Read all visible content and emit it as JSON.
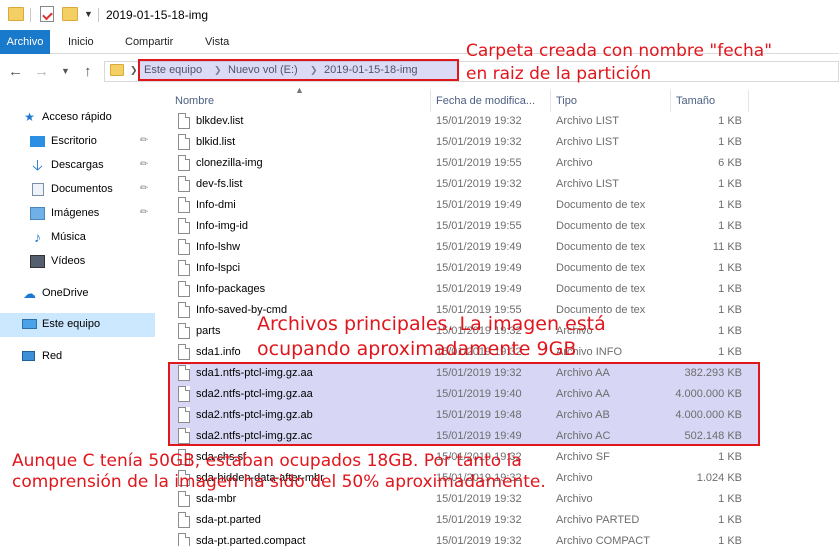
{
  "window": {
    "title": "2019-01-15-18-img"
  },
  "ribbon": {
    "tabs": [
      "Archivo",
      "Inicio",
      "Compartir",
      "Vista"
    ]
  },
  "address": {
    "crumbs": [
      "Este equipo",
      "Nuevo vol (E:)",
      "2019-01-15-18-img"
    ]
  },
  "annotations": {
    "top_line1": "Carpeta creada con nombre \"fecha\"",
    "top_line2": "en raiz de la partición",
    "middle_line1": "Archivos principales. La imagen está",
    "middle_line2": "ocupando  aproximadamente 9GB",
    "bottom_line1": "Aunque C tenía 50GB, estaban ocupados 18GB. Por tanto la",
    "bottom_line2": "comprensión de la imagen ha sido del 50% aproximadamente."
  },
  "sidebar": {
    "items": [
      {
        "label": "Acceso rápido",
        "icon": "star-icon"
      },
      {
        "label": "Escritorio",
        "icon": "desktop-icon"
      },
      {
        "label": "Descargas",
        "icon": "download-icon"
      },
      {
        "label": "Documentos",
        "icon": "documents-icon"
      },
      {
        "label": "Imágenes",
        "icon": "pictures-icon"
      },
      {
        "label": "Música",
        "icon": "music-icon"
      },
      {
        "label": "Vídeos",
        "icon": "videos-icon"
      },
      {
        "label": "OneDrive",
        "icon": "cloud-icon"
      },
      {
        "label": "Este equipo",
        "icon": "computer-icon"
      },
      {
        "label": "Red",
        "icon": "network-icon"
      }
    ]
  },
  "columns": {
    "name": "Nombre",
    "date": "Fecha de modifica...",
    "type": "Tipo",
    "size": "Tamaño"
  },
  "files": [
    {
      "name": "blkdev.list",
      "date": "15/01/2019 19:32",
      "type": "Archivo LIST",
      "size": "1 KB"
    },
    {
      "name": "blkid.list",
      "date": "15/01/2019 19:32",
      "type": "Archivo LIST",
      "size": "1 KB"
    },
    {
      "name": "clonezilla-img",
      "date": "15/01/2019 19:55",
      "type": "Archivo",
      "size": "6 KB"
    },
    {
      "name": "dev-fs.list",
      "date": "15/01/2019 19:32",
      "type": "Archivo LIST",
      "size": "1 KB"
    },
    {
      "name": "Info-dmi",
      "date": "15/01/2019 19:49",
      "type": "Documento de tex",
      "size": "1 KB"
    },
    {
      "name": "Info-img-id",
      "date": "15/01/2019 19:55",
      "type": "Documento de tex",
      "size": "1 KB"
    },
    {
      "name": "Info-lshw",
      "date": "15/01/2019 19:49",
      "type": "Documento de tex",
      "size": "11 KB"
    },
    {
      "name": "Info-lspci",
      "date": "15/01/2019 19:49",
      "type": "Documento de tex",
      "size": "1 KB"
    },
    {
      "name": "Info-packages",
      "date": "15/01/2019 19:49",
      "type": "Documento de tex",
      "size": "1 KB"
    },
    {
      "name": "Info-saved-by-cmd",
      "date": "15/01/2019 19:55",
      "type": "Documento de tex",
      "size": "1 KB"
    },
    {
      "name": "parts",
      "date": "15/01/2019 19:32",
      "type": "Archivo",
      "size": "1 KB"
    },
    {
      "name": "sda1.info",
      "date": "15/01/2019 19:32",
      "type": "Archivo INFO",
      "size": "1 KB"
    },
    {
      "name": "sda1.ntfs-ptcl-img.gz.aa",
      "date": "15/01/2019 19:32",
      "type": "Archivo AA",
      "size": "382.293 KB"
    },
    {
      "name": "sda2.ntfs-ptcl-img.gz.aa",
      "date": "15/01/2019 19:40",
      "type": "Archivo AA",
      "size": "4.000.000 KB"
    },
    {
      "name": "sda2.ntfs-ptcl-img.gz.ab",
      "date": "15/01/2019 19:48",
      "type": "Archivo AB",
      "size": "4.000.000 KB"
    },
    {
      "name": "sda2.ntfs-ptcl-img.gz.ac",
      "date": "15/01/2019 19:49",
      "type": "Archivo AC",
      "size": "502.148 KB"
    },
    {
      "name": "sda-chs.sf",
      "date": "15/01/2019 19:32",
      "type": "Archivo SF",
      "size": "1 KB"
    },
    {
      "name": "sda-hidden-data-after-mbr",
      "date": "15/01/2019 19:32",
      "type": "Archivo",
      "size": "1.024 KB"
    },
    {
      "name": "sda-mbr",
      "date": "15/01/2019 19:32",
      "type": "Archivo",
      "size": "1 KB"
    },
    {
      "name": "sda-pt.parted",
      "date": "15/01/2019 19:32",
      "type": "Archivo PARTED",
      "size": "1 KB"
    },
    {
      "name": "sda-pt.parted.compact",
      "date": "15/01/2019 19:32",
      "type": "Archivo COMPACT",
      "size": "1 KB"
    }
  ],
  "colors": {
    "accent": "#1979ca",
    "annotation": "#e0161d",
    "selection": "#cce8ff"
  }
}
